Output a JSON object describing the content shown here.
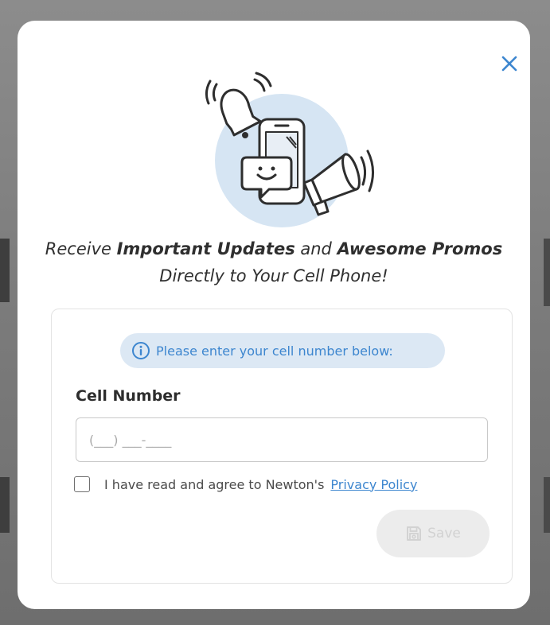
{
  "modal": {
    "close_icon": "close-icon",
    "hero_icons": [
      "bell-icon",
      "smartphone-icon",
      "chat-smiley-icon",
      "megaphone-icon"
    ],
    "headline": {
      "part1": "Receive ",
      "bold1": "Important Updates",
      "part2": " and ",
      "bold2": "Awesome Promos",
      "part3": " Directly to Your Cell Phone!"
    }
  },
  "form": {
    "info_icon": "info-icon",
    "info_text": "Please enter your cell number below:",
    "cell_label": "Cell Number",
    "cell_placeholder": "(___) ___-____",
    "cell_value": "",
    "agree_text": "I have read and agree to Newton's",
    "privacy_link": "Privacy Policy",
    "save_icon": "save-icon",
    "save_label": "Save"
  },
  "colors": {
    "accent": "#3d86cf",
    "info_pill_bg": "#dce8f4",
    "hero_circle": "#d6e5f3",
    "disabled_button_bg": "#ececec",
    "disabled_button_text": "#d2d2d2"
  }
}
